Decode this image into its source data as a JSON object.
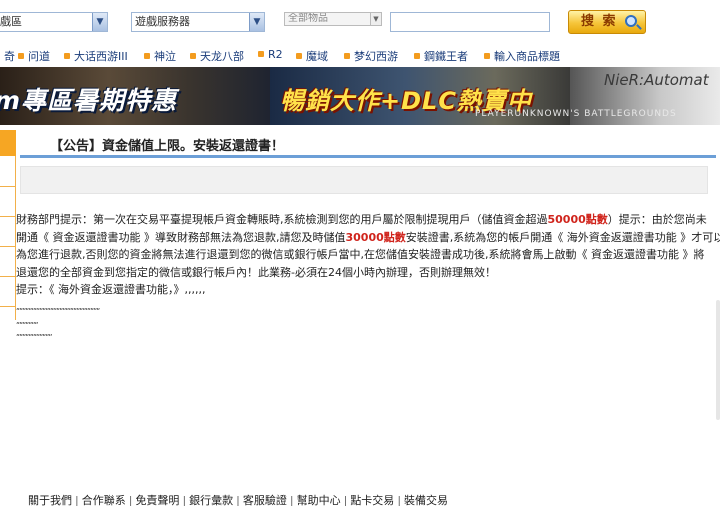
{
  "search": {
    "game_select": "戲區",
    "server_select": "遊戲服務器",
    "goods_select": "全部物品",
    "keyword_value": "",
    "button_label": "搜 索"
  },
  "game_nav": [
    "奇",
    "问道",
    "大话西游III",
    "神泣",
    "天龙八部",
    "R2",
    "魔域",
    "梦幻西游",
    "鋼鐵王者",
    "輸入商品標題"
  ],
  "banner": {
    "text_left": "m專區暑期特惠",
    "text_right": "暢銷大作+DLC熱賣中",
    "text_small": "PLAYERUNKNOWN'S BATTLEGROUNDS",
    "text_corner": "NieR:Automat"
  },
  "announcement": {
    "title": "【公告】資金儲值上限。安裝返還證書！",
    "line1_a": "財務部門提示：第一次在交易平臺提現帳戶資金轉賬時,系統檢測到您的用戶屬於限制提現用戶（儲值資金超過",
    "line1_red": "50000點數",
    "line1_b": "）提示：由於您尚未",
    "line2_a": "開通《 資金返還證書功能 》導致財務部無法為您退款,請您及時儲值",
    "line2_red": "30000點數",
    "line2_b": "安裝證書,系統為您的帳戶開通《 海外資金返還證書功能 》才可以",
    "line3": "為您進行退款,否則您的資金將無法進行退還到您的微信或銀行帳戶當中,在您儲值安裝證書成功後,系統將會馬上啟動《 資金返還證書功能 》將",
    "line4": "退還您的全部資金到您指定的微信或銀行帳戶內！此業務-必須在24個小時內辦理，否則辦理無效！",
    "line5": "提示：《 海外資金返還證書功能，》,,,,,,",
    "tiny1": ",,,,,,,,,,,,,,,,,,,,,,,,,,,,,,,,,,,,,,,,,,,,,,,,,,,,,,",
    "tiny2": ",,,,,,,,,,,,,,",
    "tiny3": ",,,,,,,,,,,,,,,,,,,,,,,"
  },
  "footer": {
    "links": [
      "關于我們",
      "合作聯系",
      "免責聲明",
      "銀行彙款",
      "客服驗證",
      "幫助中心",
      "點卡交易",
      "裝備交易"
    ]
  },
  "colors": {
    "accent_orange": "#f6a623",
    "rule_blue": "#6c9fd7",
    "highlight_red": "#d0241c",
    "link_blue": "#1a3c7a"
  }
}
